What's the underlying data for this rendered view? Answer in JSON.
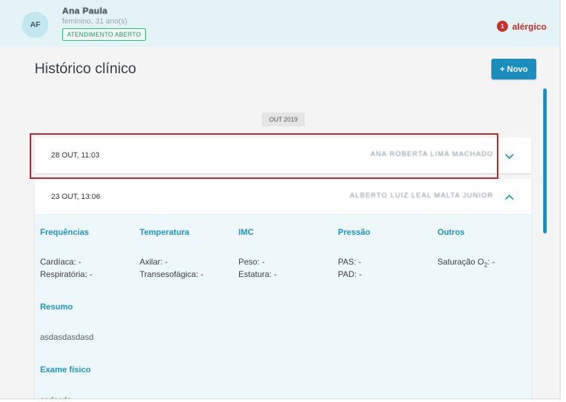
{
  "patient": {
    "initials": "AF",
    "name": "Ana Paula",
    "meta": "feminino, 31 ano(s)",
    "status": "ATENDIMENTO ABERTO",
    "allergy_count": "1",
    "allergy_label": "alérgico"
  },
  "page": {
    "title": "Histórico clínico",
    "new_button": "+ Novo"
  },
  "timeline": {
    "month": "OUT 2019",
    "entries": [
      {
        "date": "28 OUT, 11:03",
        "doctor": "ANA ROBERTA LIMA MACHADO",
        "expanded": false
      },
      {
        "date": "23 OUT, 13:06",
        "doctor": "ALBERTO LUIZ LEAL MALTA JUNIOR",
        "expanded": true
      }
    ]
  },
  "vitals": {
    "frequencias": {
      "label": "Frequências",
      "cardiaca": "Cardíaca: -",
      "respiratoria": "Respiratória: -"
    },
    "temperatura": {
      "label": "Temperatura",
      "axilar": "Axilar: -",
      "transesofagica": "Transesofágica: -"
    },
    "imc": {
      "label": "IMC",
      "peso": "Peso: -",
      "estatura": "Estatura: -"
    },
    "pressao": {
      "label": "Pressão",
      "pas": "PAS: -",
      "pad": "PAD: -"
    },
    "outros": {
      "label": "Outros",
      "saturacao_prefix": "Saturação O",
      "saturacao_sub": "2",
      "saturacao_suffix": ": -"
    }
  },
  "resumo": {
    "label": "Resumo",
    "text": "asdasdasdasd"
  },
  "exame_fisico": {
    "label": "Exame físico",
    "text": "asdasda"
  },
  "colors": {
    "accent": "#1a8fbf",
    "alert": "#c9302c",
    "status": "#1e9e62"
  }
}
